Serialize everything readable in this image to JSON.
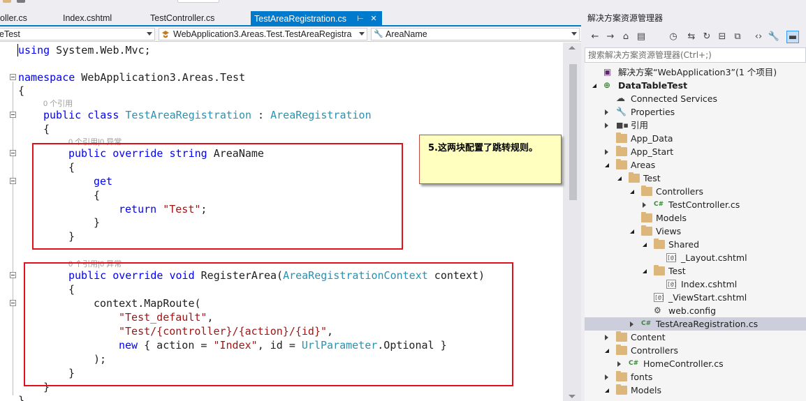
{
  "editor": {
    "tabs": [
      {
        "label": "oller.cs",
        "active": false
      },
      {
        "label": "Index.cshtml",
        "active": false
      },
      {
        "label": "TestController.cs",
        "active": false
      },
      {
        "label": "TestAreaRegistration.cs",
        "active": true
      }
    ],
    "tab_pin_glyph": "⊢",
    "tab_close_glyph": "✕",
    "nav": {
      "project_combo": "eTest",
      "type_combo": "WebApplication3.Areas.Test.TestAreaRegistra",
      "member_combo": "AreaName"
    },
    "code": {
      "l_using": [
        "using",
        " System.Web.Mvc;"
      ],
      "l_namespace": [
        "namespace",
        " WebApplication3.Areas.Test"
      ],
      "lens_class": "0 个引用",
      "l_class": [
        "public",
        " ",
        "class",
        " ",
        "TestAreaRegistration",
        " : ",
        "AreaRegistration"
      ],
      "lens_prop": "0 个引用|0 异常",
      "l_prop": [
        "public",
        " ",
        "override",
        " ",
        "string",
        " AreaName"
      ],
      "l_get": "get",
      "l_return": [
        "return",
        " ",
        "\"Test\"",
        ";"
      ],
      "lens_method": "0 个引用|0 异常",
      "l_method": [
        "public",
        " ",
        "override",
        " ",
        "void",
        " RegisterArea(",
        "AreaRegistrationContext",
        " context)"
      ],
      "l_maproute": "context.MapRoute(",
      "l_route_name": [
        "\"Test_default\"",
        ","
      ],
      "l_route_url": [
        "\"Test/{controller}/{action}/{id}\"",
        ","
      ],
      "l_defaults": [
        "new",
        " { action = ",
        "\"Index\"",
        ", id = ",
        "UrlParameter",
        ".Optional }"
      ],
      "l_close_call": ");",
      "brace_open": "{",
      "brace_close": "}"
    },
    "callout_text": "5.这两块配置了跳转规则。",
    "colors": {
      "keyword": "#0000ff",
      "type": "#2b91af",
      "string": "#a31515",
      "annotation": "#e0101e",
      "accent": "#007acc"
    }
  },
  "solution_explorer": {
    "title": "解决方案资源管理器",
    "search_placeholder": "搜索解决方案资源管理器(Ctrl+;)",
    "tree": [
      {
        "label": "解决方案“WebApplication3”(1 个项目)",
        "icon": "solution-icon",
        "glyph": "▣",
        "depth": 0,
        "twisty": "none"
      },
      {
        "label": "DataTableTest",
        "icon": "project-icon",
        "glyph": "⊕",
        "depth": 0,
        "twisty": "expanded",
        "bold": true
      },
      {
        "label": "Connected Services",
        "icon": "cloud-icon",
        "glyph": "☁",
        "depth": 1,
        "twisty": "none"
      },
      {
        "label": "Properties",
        "icon": "wrench-icon",
        "glyph": "🔧",
        "depth": 1,
        "twisty": "collapsed"
      },
      {
        "label": "引用",
        "icon": "references-icon",
        "glyph": "■▪",
        "depth": 1,
        "twisty": "collapsed"
      },
      {
        "label": "App_Data",
        "icon": "folder-icon",
        "depth": 1,
        "twisty": "none"
      },
      {
        "label": "App_Start",
        "icon": "folder-icon",
        "depth": 1,
        "twisty": "collapsed"
      },
      {
        "label": "Areas",
        "icon": "folder-icon",
        "depth": 1,
        "twisty": "expanded"
      },
      {
        "label": "Test",
        "icon": "folder-icon",
        "depth": 2,
        "twisty": "expanded"
      },
      {
        "label": "Controllers",
        "icon": "folder-icon",
        "depth": 3,
        "twisty": "expanded"
      },
      {
        "label": "TestController.cs",
        "icon": "csharp-file-icon",
        "glyph": "C#",
        "depth": 4,
        "twisty": "collapsed"
      },
      {
        "label": "Models",
        "icon": "folder-icon",
        "depth": 3,
        "twisty": "none"
      },
      {
        "label": "Views",
        "icon": "folder-icon",
        "depth": 3,
        "twisty": "expanded"
      },
      {
        "label": "Shared",
        "icon": "folder-icon",
        "depth": 4,
        "twisty": "expanded"
      },
      {
        "label": "_Layout.cshtml",
        "icon": "cshtml-file-icon",
        "glyph": "[@]",
        "depth": 5,
        "twisty": "none"
      },
      {
        "label": "Test",
        "icon": "folder-icon",
        "depth": 4,
        "twisty": "expanded"
      },
      {
        "label": "Index.cshtml",
        "icon": "cshtml-file-icon",
        "glyph": "[@]",
        "depth": 5,
        "twisty": "none"
      },
      {
        "label": "_ViewStart.cshtml",
        "icon": "cshtml-file-icon",
        "glyph": "[@]",
        "depth": 4,
        "twisty": "none"
      },
      {
        "label": "web.config",
        "icon": "config-file-icon",
        "glyph": "⚙",
        "depth": 4,
        "twisty": "none"
      },
      {
        "label": "TestAreaRegistration.cs",
        "icon": "csharp-file-icon",
        "glyph": "C#",
        "depth": 3,
        "twisty": "collapsed",
        "selected": true
      },
      {
        "label": "Content",
        "icon": "folder-icon",
        "depth": 1,
        "twisty": "collapsed"
      },
      {
        "label": "Controllers",
        "icon": "folder-icon",
        "depth": 1,
        "twisty": "expanded"
      },
      {
        "label": "HomeController.cs",
        "icon": "csharp-file-icon",
        "glyph": "C#",
        "depth": 2,
        "twisty": "collapsed"
      },
      {
        "label": "fonts",
        "icon": "folder-icon",
        "depth": 1,
        "twisty": "collapsed"
      },
      {
        "label": "Models",
        "icon": "folder-icon",
        "depth": 1,
        "twisty": "expanded"
      }
    ],
    "toolbar": [
      {
        "name": "back-icon",
        "glyph": "←"
      },
      {
        "name": "forward-icon",
        "glyph": "→"
      },
      {
        "name": "home-icon",
        "glyph": "⌂"
      },
      {
        "name": "switch-views-icon",
        "glyph": "▤"
      },
      {
        "name": "pending-changes-icon",
        "glyph": "◷"
      },
      {
        "name": "sync-icon",
        "glyph": "⇆"
      },
      {
        "name": "refresh-icon",
        "glyph": "↻"
      },
      {
        "name": "collapse-all-icon",
        "glyph": "⊟"
      },
      {
        "name": "show-all-files-icon",
        "glyph": "⧉"
      },
      {
        "name": "view-code-icon",
        "glyph": "‹›"
      },
      {
        "name": "properties-icon",
        "glyph": "🔧"
      },
      {
        "name": "preview-selected-icon",
        "glyph": "▬"
      }
    ]
  }
}
